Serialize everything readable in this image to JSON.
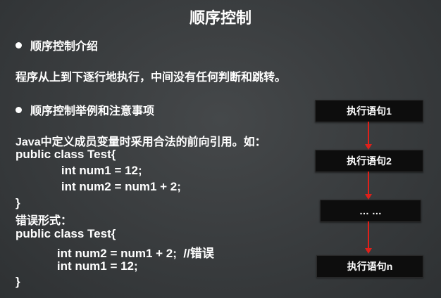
{
  "title": "顺序控制",
  "section1": {
    "heading": "顺序控制介绍",
    "description": "程序从上到下逐行地执行，中间没有任何判断和跳转。"
  },
  "section2": {
    "heading": "顺序控制举例和注意事项",
    "intro": "Java中定义成员变量时采用合法的前向引用。如：",
    "code_correct": [
      "public class Test{",
      "    int num1 = 12;",
      "    int num2 = num1 + 2;",
      "}"
    ],
    "error_label": "错误形式：",
    "code_error": [
      "public class Test{",
      "    int num2 = num1 + 2;  //错误",
      "    int num1 = 12;",
      "}"
    ]
  },
  "flowchart": {
    "steps": [
      "执行语句1",
      "执行语句2",
      "… …",
      "执行语句n"
    ],
    "arrow_color": "#e0201a",
    "box_color": "#0d0d0d"
  }
}
